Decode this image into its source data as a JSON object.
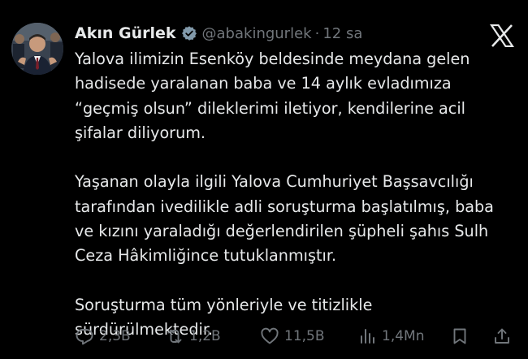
{
  "post": {
    "author": {
      "display_name": "Akın Gürlek",
      "handle": "@abakingurlek",
      "separator": "·",
      "time": "12 sa",
      "avatar_icon": "profile-photo",
      "verified_icon": "verified-badge-icon"
    },
    "platform_icon": "x-logo-icon",
    "text": "Yalova ilimizin Esenköy beldesinde meydana gelen\nhadisede yaralanan baba ve 14 aylık evladımıza\n“geçmiş olsun” dileklerimi iletiyor, kendilerine acil\nşifalar diliyorum.\n\nYaşanan olayla ilgili Yalova Cumhuriyet Başsavcılığı\ntarafından ivedilikle adli soruşturma başlatılmış, baba\nve kızını yaraladığı değerlendirilen şüpheli şahıs Sulh\nCeza Hâkimliğince tutuklanmıştır.\n\nSoruşturma tüm yönleriyle ve titizlikle\nsürdürülmektedir.",
    "actions": {
      "replies": "2,3B",
      "reposts": "1,2B",
      "likes": "11,5B",
      "views": "1,4Mn"
    }
  },
  "colors": {
    "background": "#000000",
    "primary_text": "#e7e9ea",
    "secondary_text": "#71767b",
    "verified_badge": "#829aab"
  }
}
